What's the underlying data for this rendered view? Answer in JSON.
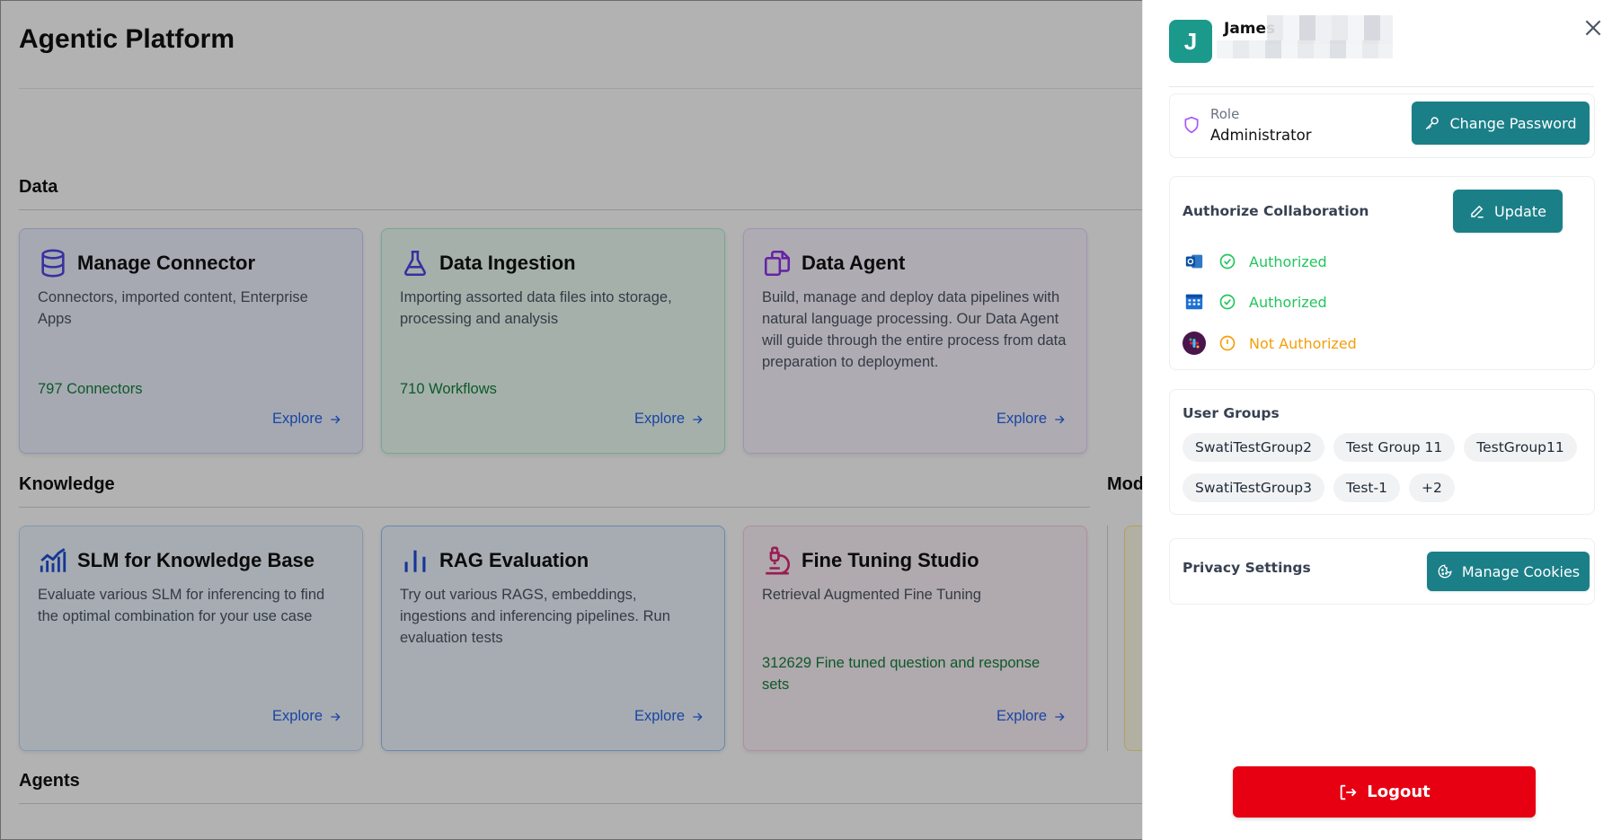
{
  "app": {
    "title": "Agentic Platform"
  },
  "sections": {
    "data": "Data",
    "knowledge": "Knowledge",
    "models_partial": "Mode",
    "agents": "Agents"
  },
  "cards": [
    {
      "title": "Manage Connector",
      "description": "Connectors, imported content, Enterprise Apps",
      "count": "797 Connectors",
      "explore": "Explore",
      "icon": "database-icon"
    },
    {
      "title": "Data Ingestion",
      "description": "Importing assorted data files into storage, processing and analysis",
      "count": "710 Workflows",
      "explore": "Explore",
      "icon": "flask-icon"
    },
    {
      "title": "Data Agent",
      "description": "Build, manage and deploy data pipelines with natural language processing. Our Data Agent will guide through the entire process from data preparation to deployment.",
      "count": "",
      "explore": "Explore",
      "icon": "copy-files-icon"
    },
    {
      "title": "SLM for Knowledge Base",
      "description": "Evaluate various SLM for inferencing to find the optimal combination for your use case",
      "count": "",
      "explore": "Explore",
      "icon": "bar-line-chart-icon"
    },
    {
      "title": "RAG Evaluation",
      "description": "Try out various RAGS, embeddings, ingestions and inferencing pipelines. Run evaluation tests",
      "count": "",
      "explore": "Explore",
      "icon": "bar-chart-icon"
    },
    {
      "title": "Fine Tuning Studio",
      "description": "Retrieval Augmented Fine Tuning",
      "count": "312629 Fine tuned question and response sets",
      "explore": "Explore",
      "icon": "microscope-icon"
    }
  ],
  "drawer": {
    "avatar_letter": "J",
    "user_name": "James",
    "role": {
      "label": "Role",
      "value": "Administrator"
    },
    "change_password": "Change Password",
    "collaboration": {
      "title": "Authorize Collaboration",
      "update": "Update",
      "items": [
        {
          "app_icon": "outlook-icon",
          "status": "Authorized",
          "state": "ok"
        },
        {
          "app_icon": "calendar-icon",
          "status": "Authorized",
          "state": "ok"
        },
        {
          "app_icon": "slack-icon",
          "status": "Not Authorized",
          "state": "warn"
        }
      ]
    },
    "groups": {
      "title": "User Groups",
      "chips": [
        "SwatiTestGroup2",
        "Test Group 11",
        "TestGroup11",
        "SwatiTestGroup3",
        "Test-1",
        "+2"
      ]
    },
    "privacy": {
      "title": "Privacy Settings",
      "manage_cookies": "Manage Cookies"
    },
    "logout": "Logout"
  },
  "colors": {
    "teal": "#1b7f88",
    "avatar": "#1b9a8c",
    "logout": "#e60012",
    "authorized": "#22c55e",
    "not_authorized": "#f59e0b"
  }
}
